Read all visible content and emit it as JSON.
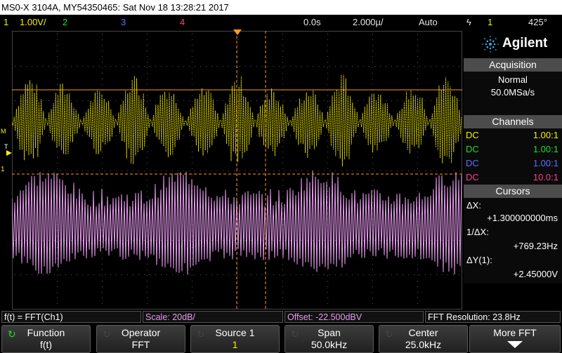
{
  "title_bar": "MS0-X 3104A, MY54350465: Sat Nov 18 13:28:21 2017",
  "channel_bar": {
    "ch1_num": "1",
    "ch1_scale": "1.00V/",
    "ch2_num": "2",
    "ch3_num": "3",
    "ch4_num": "4",
    "delay": "0.0s",
    "timebase": "2.000µ/",
    "trigger_mode": "Auto",
    "trigger_icon": "ϟ",
    "trigger_src": "1",
    "trigger_level": "425°"
  },
  "left_markers": {
    "math": "M",
    "trig": "T",
    "ch1": "1"
  },
  "sidebar": {
    "brand": "Agilent",
    "acquisition": {
      "header": "Acquisition",
      "mode": "Normal",
      "rate": "50.0MSa/s"
    },
    "channels": {
      "header": "Channels",
      "rows": [
        {
          "coupling": "DC",
          "probe": "1.00:1",
          "color": "#f7f000"
        },
        {
          "coupling": "DC",
          "probe": "1.00:1",
          "color": "#22dd22"
        },
        {
          "coupling": "DC",
          "probe": "1.00:1",
          "color": "#5b6cff"
        },
        {
          "coupling": "DC",
          "probe": "10.0:1",
          "color": "#ff3f8c"
        }
      ]
    },
    "cursors": {
      "header": "Cursors",
      "dx_label": "ΔX:",
      "dx_value": "+1.300000000ms",
      "inv_label": "1/ΔX:",
      "inv_value": "+769.23Hz",
      "dy_label": "ΔY(1):",
      "dy_value": "+2.45000V"
    }
  },
  "status": {
    "func": "f(t) = FFT(Ch1)",
    "scale": "Scale: 20dB/",
    "offset": "Offset: -22.500dBV",
    "resolution": "FFT Resolution: 23.8Hz"
  },
  "softkeys": [
    {
      "label": "Function",
      "value": "f(t)",
      "icon": "rotate-knob-icon",
      "active": true
    },
    {
      "label": "Operator",
      "value": "FFT",
      "icon": "rotate-knob-icon",
      "active": false
    },
    {
      "label": "Source 1",
      "value": "1",
      "icon": "rotate-knob-icon",
      "active": false
    },
    {
      "label": "Span",
      "value": "50.0kHz",
      "icon": "rotate-knob-icon",
      "active": false
    },
    {
      "label": "Center",
      "value": "25.0kHz",
      "icon": "rotate-knob-icon",
      "active": false
    },
    {
      "label": "More FFT",
      "value": "",
      "icon": "down-arrow-icon",
      "active": false
    }
  ],
  "colors": {
    "ch1": "#f7f000",
    "ch2": "#22dd22",
    "ch3": "#5b6cff",
    "ch4": "#ff3f8c",
    "math_trace": "#e89bf0",
    "cursor": "#ff9a1a",
    "grid": "#5a5a5a"
  }
}
